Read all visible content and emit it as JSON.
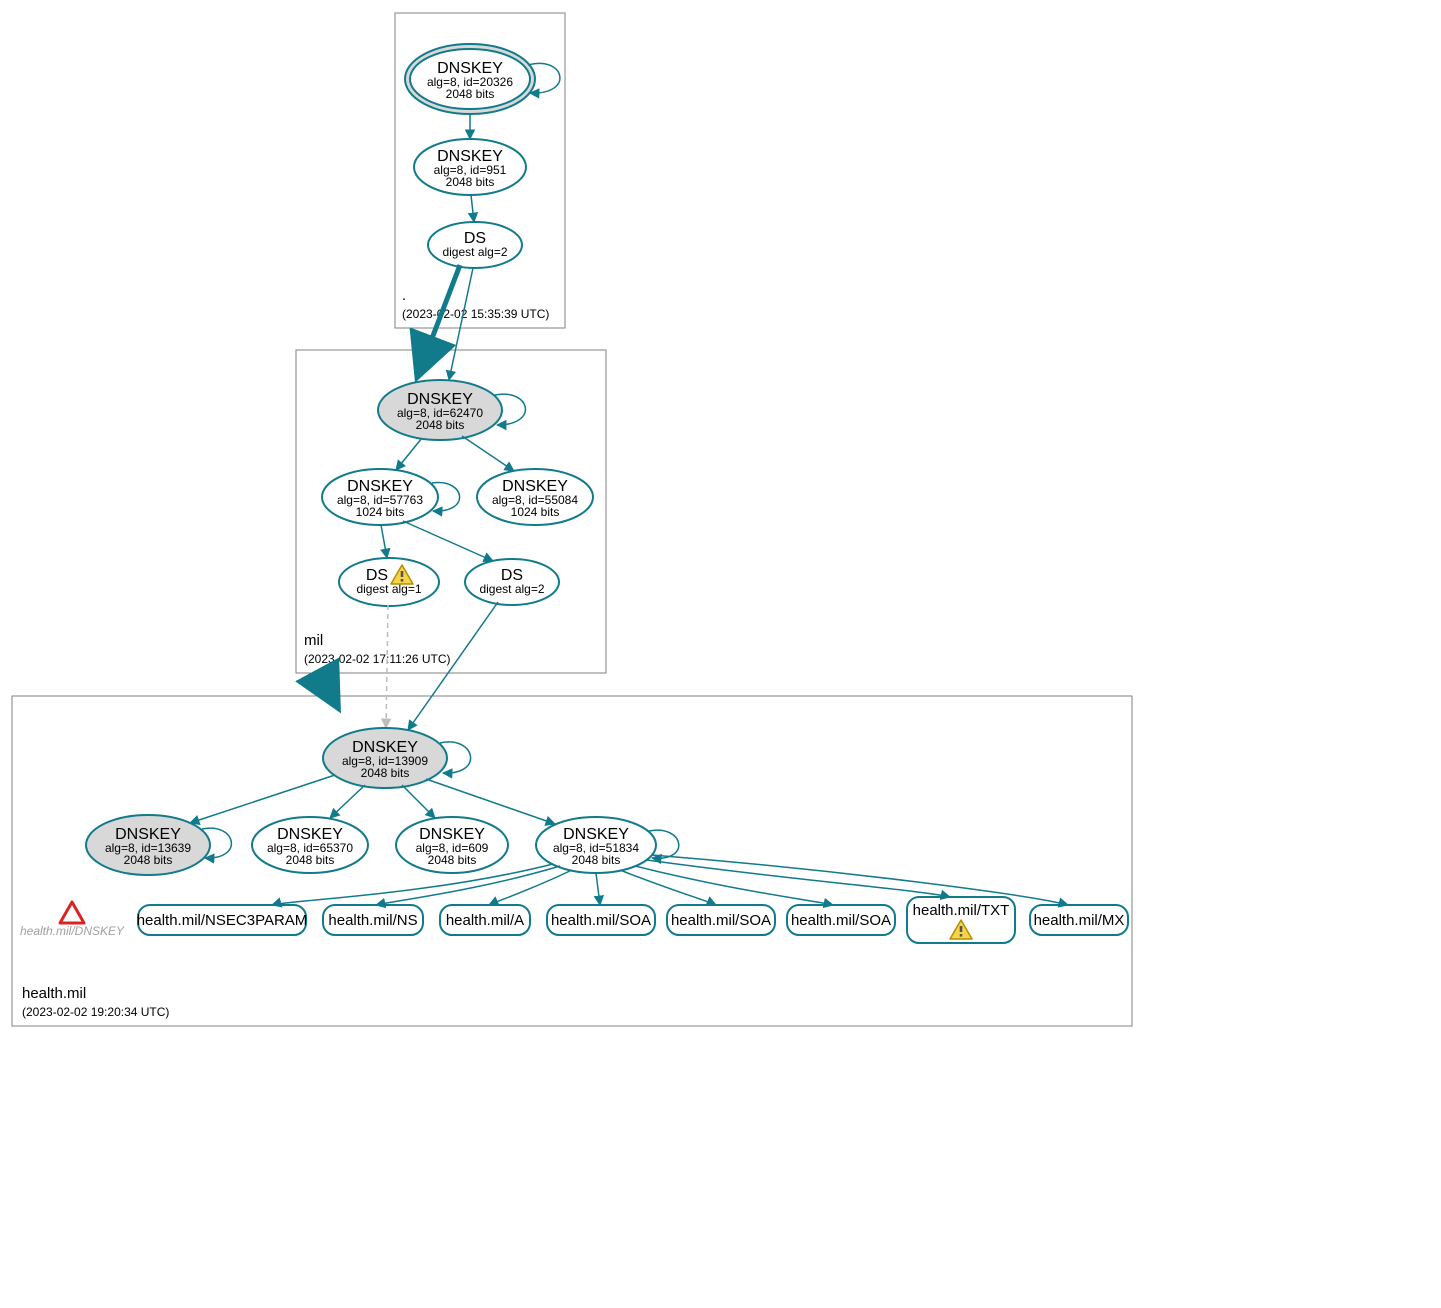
{
  "zones": {
    "root": {
      "name": ".",
      "timestamp": "(2023-02-02 15:35:39 UTC)"
    },
    "mil": {
      "name": "mil",
      "timestamp": "(2023-02-02 17:11:26 UTC)"
    },
    "health": {
      "name": "health.mil",
      "timestamp": "(2023-02-02 19:20:34 UTC)"
    }
  },
  "nodes": {
    "root_ksk": {
      "title": "DNSKEY",
      "line1": "alg=8, id=20326",
      "line2": "2048 bits"
    },
    "root_zsk": {
      "title": "DNSKEY",
      "line1": "alg=8, id=951",
      "line2": "2048 bits"
    },
    "root_ds": {
      "title": "DS",
      "line1": "digest alg=2"
    },
    "mil_ksk": {
      "title": "DNSKEY",
      "line1": "alg=8, id=62470",
      "line2": "2048 bits"
    },
    "mil_zsk1": {
      "title": "DNSKEY",
      "line1": "alg=8, id=57763",
      "line2": "1024 bits"
    },
    "mil_zsk2": {
      "title": "DNSKEY",
      "line1": "alg=8, id=55084",
      "line2": "1024 bits"
    },
    "mil_ds1": {
      "title": "DS",
      "line1": "digest alg=1"
    },
    "mil_ds2": {
      "title": "DS",
      "line1": "digest alg=2"
    },
    "h_ksk": {
      "title": "DNSKEY",
      "line1": "alg=8, id=13909",
      "line2": "2048 bits"
    },
    "h_k1": {
      "title": "DNSKEY",
      "line1": "alg=8, id=13639",
      "line2": "2048 bits"
    },
    "h_k2": {
      "title": "DNSKEY",
      "line1": "alg=8, id=65370",
      "line2": "2048 bits"
    },
    "h_k3": {
      "title": "DNSKEY",
      "line1": "alg=8, id=609",
      "line2": "2048 bits"
    },
    "h_k4": {
      "title": "DNSKEY",
      "line1": "alg=8, id=51834",
      "line2": "2048 bits"
    }
  },
  "records": {
    "nsec3": "health.mil/NSEC3PARAM",
    "ns": "health.mil/NS",
    "a": "health.mil/A",
    "soa1": "health.mil/SOA",
    "soa2": "health.mil/SOA",
    "soa3": "health.mil/SOA",
    "txt": "health.mil/TXT",
    "mx": "health.mil/MX"
  },
  "warn_label": "health.mil/DNSKEY"
}
